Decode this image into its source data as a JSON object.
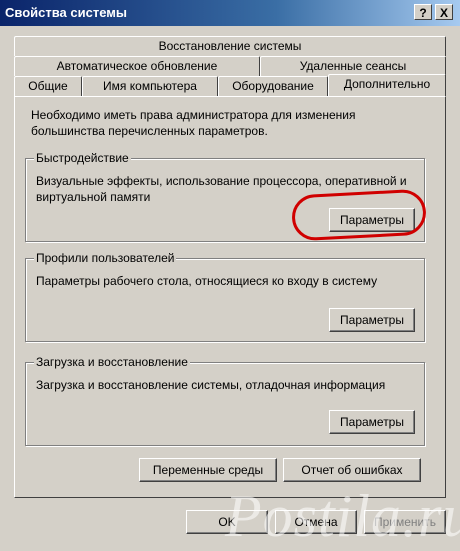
{
  "window": {
    "title": "Свойства системы",
    "help_btn": "?",
    "close_btn": "X"
  },
  "tabs": {
    "row1": [
      "Восстановление системы"
    ],
    "row2": [
      "Автоматическое обновление",
      "Удаленные сеансы"
    ],
    "row3": [
      "Общие",
      "Имя компьютера",
      "Оборудование",
      "Дополнительно"
    ],
    "active": "Дополнительно"
  },
  "info_text": "Необходимо иметь права администратора для изменения большинства перечисленных параметров.",
  "groups": {
    "performance": {
      "label": "Быстродействие",
      "text": "Визуальные эффекты, использование процессора, оперативной и виртуальной памяти",
      "button": "Параметры"
    },
    "profiles": {
      "label": "Профили пользователей",
      "text": "Параметры рабочего стола, относящиеся ко входу в систему",
      "button": "Параметры"
    },
    "startup": {
      "label": "Загрузка и восстановление",
      "text": "Загрузка и восстановление системы, отладочная информация",
      "button": "Параметры"
    }
  },
  "buttons": {
    "env_vars": "Переменные среды",
    "error_report": "Отчет об ошибках",
    "ok": "OK",
    "cancel": "Отмена",
    "apply": "Применить"
  },
  "watermark": "Postila.ru",
  "colors": {
    "highlight": "#d00000",
    "titlebar": "#0a246a"
  }
}
